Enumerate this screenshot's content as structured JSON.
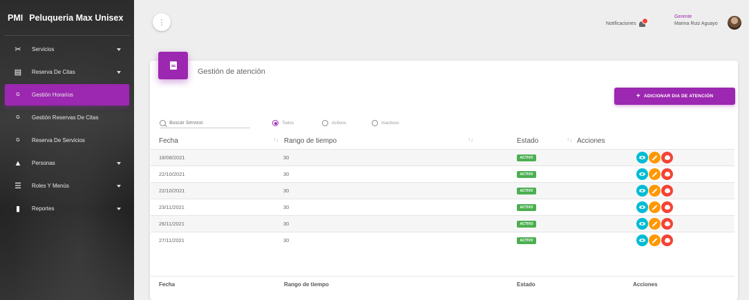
{
  "brand": {
    "mini": "PMI",
    "name": "Peluqueria Max Unisex"
  },
  "nav": [
    {
      "icon": "✂",
      "label": "Servicios",
      "caret": true,
      "active": false,
      "sub": false
    },
    {
      "icon": "▤",
      "label": "Reserva De Citas",
      "caret": true,
      "active": false,
      "sub": false
    },
    {
      "icon": "G",
      "label": "Gestión Horarios",
      "caret": false,
      "active": true,
      "sub": true
    },
    {
      "icon": "G",
      "label": "Gestión Reservas De Citas",
      "caret": false,
      "active": false,
      "sub": true
    },
    {
      "icon": "G",
      "label": "Reserva De Servicios",
      "caret": false,
      "active": false,
      "sub": true
    },
    {
      "icon": "▲",
      "label": "Personas",
      "caret": true,
      "active": false,
      "sub": false
    },
    {
      "icon": "☰",
      "label": "Roles Y Menús",
      "caret": true,
      "active": false,
      "sub": false
    },
    {
      "icon": "▮",
      "label": "Reportes",
      "caret": true,
      "active": false,
      "sub": false
    }
  ],
  "topbar": {
    "menu_glyph": "⋮",
    "notifications_label": "Notificaciones",
    "user_role": "Gerente",
    "user_name": "Marina Ruiz Aguayo"
  },
  "card": {
    "title": "Gestión de atención",
    "add_button": "ADICIONAR DIA DE ATENCIÓN",
    "search_placeholder": "Buscar Servicio",
    "filters": [
      {
        "label": "Todos",
        "selected": true
      },
      {
        "label": "Activos",
        "selected": false
      },
      {
        "label": "Inactivos",
        "selected": false
      }
    ]
  },
  "table": {
    "headers": {
      "fecha": "Fecha",
      "rango": "Rango de tiempo",
      "estado": "Estado",
      "acciones": "Acciones"
    },
    "sort_glyph": "↑↓",
    "rows": [
      {
        "fecha": "18/08/2021",
        "rango": "30",
        "estado": "ACTIVO"
      },
      {
        "fecha": "22/10/2021",
        "rango": "30",
        "estado": "ACTIVO"
      },
      {
        "fecha": "22/10/2021",
        "rango": "30",
        "estado": "ACTIVO"
      },
      {
        "fecha": "23/11/2021",
        "rango": "30",
        "estado": "ACTIVO"
      },
      {
        "fecha": "26/11/2021",
        "rango": "30",
        "estado": "ACTIVO"
      },
      {
        "fecha": "27/11/2021",
        "rango": "30",
        "estado": "ACTIVO"
      }
    ],
    "footer": {
      "fecha": "Fecha",
      "rango": "Rango de tiempo",
      "estado": "Estado",
      "acciones": "Acciones"
    }
  },
  "colors": {
    "accent": "#9c27b0",
    "active_badge": "#4caf50",
    "view": "#00bcd4",
    "edit": "#ff9800",
    "delete": "#f44336"
  }
}
